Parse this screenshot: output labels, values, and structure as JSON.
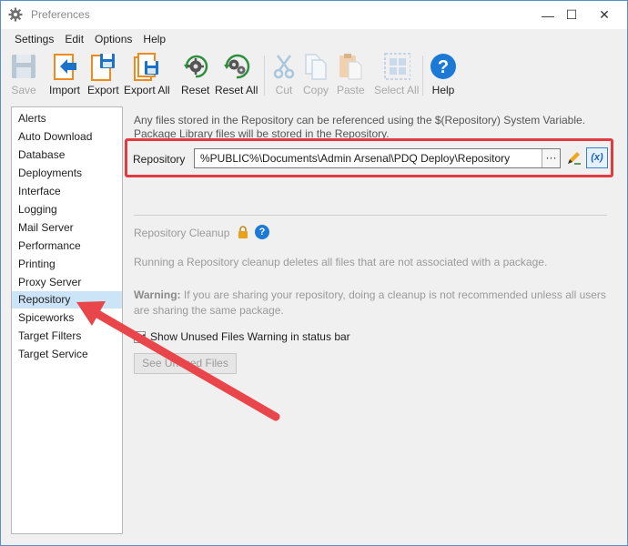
{
  "window": {
    "title": "Preferences",
    "controls": {
      "minimize": "—",
      "maximize": "☐",
      "close": "✕"
    }
  },
  "menu": [
    "Settings",
    "Edit",
    "Options",
    "Help"
  ],
  "toolbar": [
    {
      "label": "Save",
      "icon": "save-icon",
      "enabled": false
    },
    {
      "label": "Import",
      "icon": "import-icon",
      "enabled": true
    },
    {
      "label": "Export",
      "icon": "export-icon",
      "enabled": true
    },
    {
      "label": "Export All",
      "icon": "export-all-icon",
      "enabled": true
    },
    {
      "label": "Reset",
      "icon": "reset-gear-icon",
      "enabled": true
    },
    {
      "label": "Reset All",
      "icon": "reset-all-gear-icon",
      "enabled": true
    },
    {
      "label": "Cut",
      "icon": "scissors-icon",
      "enabled": false
    },
    {
      "label": "Copy",
      "icon": "copy-icon",
      "enabled": false
    },
    {
      "label": "Paste",
      "icon": "paste-icon",
      "enabled": false
    },
    {
      "label": "Select All",
      "icon": "select-all-icon",
      "enabled": false
    },
    {
      "label": "Help",
      "icon": "help-icon",
      "enabled": true
    }
  ],
  "sidebar": {
    "items": [
      "Alerts",
      "Auto Download",
      "Database",
      "Deployments",
      "Interface",
      "Logging",
      "Mail Server",
      "Performance",
      "Printing",
      "Proxy Server",
      "Repository",
      "Spiceworks",
      "Target Filters",
      "Target Service"
    ],
    "selected": "Repository"
  },
  "main": {
    "info_line1": "Any files stored in the Repository can be referenced using the $(Repository) System Variable.",
    "info_line2": "Package Library files will be stored in the Repository.",
    "repo_label": "Repository",
    "repo_path": "%PUBLIC%\\Documents\\Admin Arsenal\\PDQ Deploy\\Repository",
    "browse_label": "···",
    "variable_label": "(x)",
    "cleanup_title": "Repository Cleanup",
    "help_label": "?",
    "cleanup_desc": "Running a Repository cleanup deletes all files that are not associated with a package.",
    "warning_label": "Warning:",
    "warning_text": "If you are sharing your repository, doing a cleanup is not recommended unless all users are sharing the same package.",
    "checkbox_label": "Show Unused Files Warning in status bar",
    "checkbox_checked": true,
    "see_button": "See Unused Files"
  },
  "colors": {
    "highlight_box": "#e23a3e",
    "arrow": "#e8464a",
    "selection": "#cce4f7",
    "accent": "#1c7ad6"
  }
}
